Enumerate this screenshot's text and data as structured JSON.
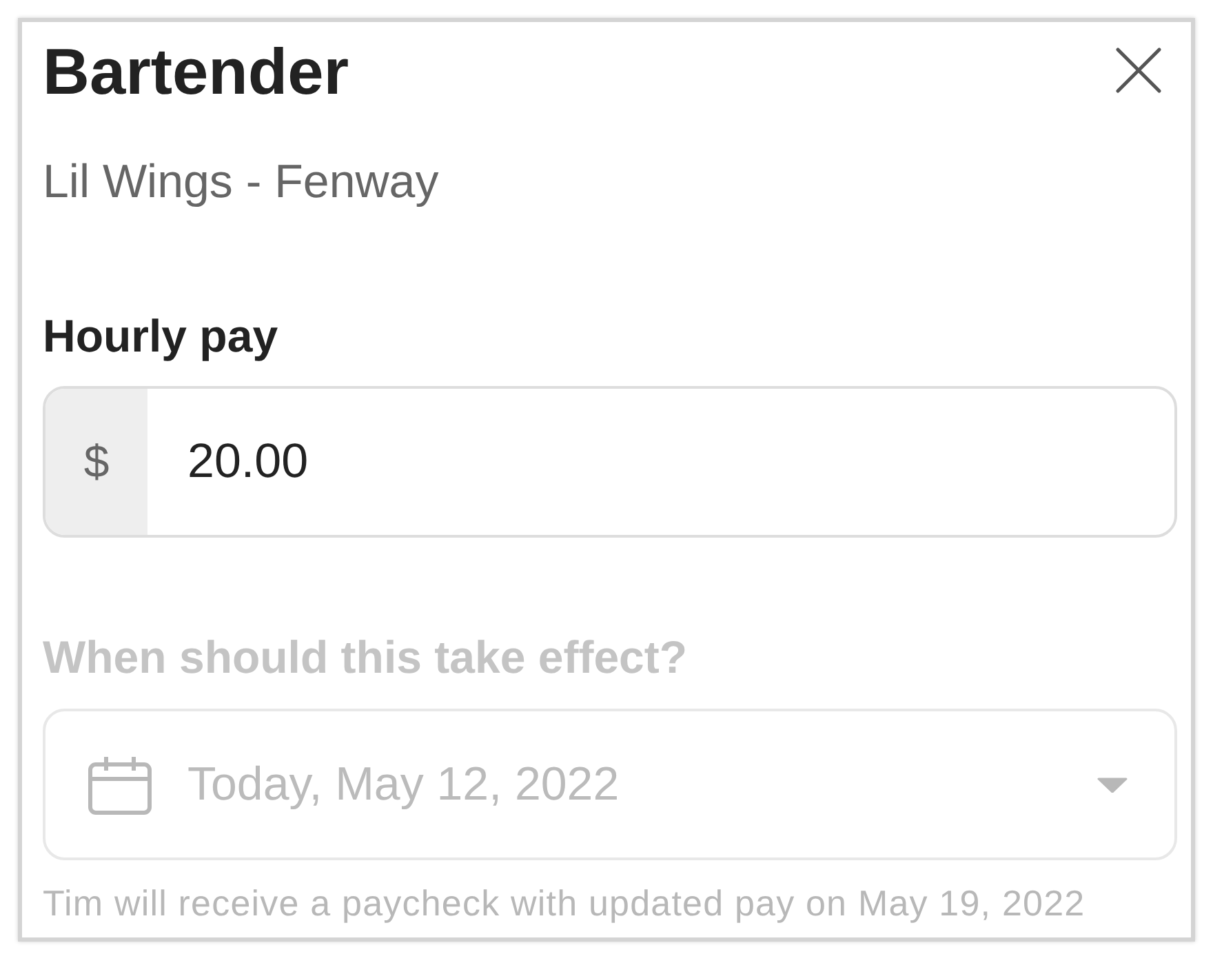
{
  "dialog": {
    "title": "Bartender",
    "subtitle": "Lil Wings - Fenway"
  },
  "fields": [
    {
      "kind": "currency",
      "label": "Hourly pay",
      "prefix": "$",
      "value": "20.00",
      "disabled": false
    },
    {
      "kind": "date",
      "label": "When should this take effect?",
      "value": "Today, May 12, 2022",
      "disabled": true,
      "helper": "Tim will receive a paycheck with updated pay on May 19, 2022"
    }
  ]
}
